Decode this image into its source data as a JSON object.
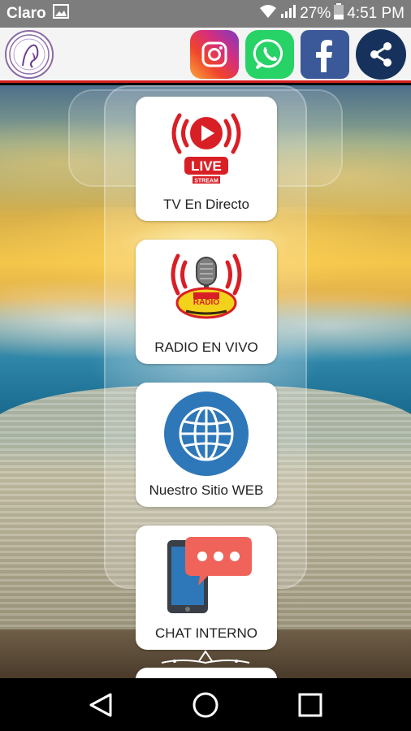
{
  "status_bar": {
    "carrier": "Claro",
    "battery": "27%",
    "time": "4:51 PM"
  },
  "app_bar": {
    "socials": [
      {
        "name": "instagram",
        "icon": "instagram-icon",
        "color": "#d42e7f"
      },
      {
        "name": "whatsapp",
        "icon": "whatsapp-icon",
        "color": "#27d266"
      },
      {
        "name": "facebook",
        "icon": "facebook-icon",
        "color": "#3b5998"
      },
      {
        "name": "share",
        "icon": "share-icon",
        "color": "#16325c"
      }
    ]
  },
  "menu": {
    "items": [
      {
        "label": "TV En Directo",
        "icon": "live-stream-icon",
        "badge_text": "LIVE",
        "badge_sub": "STREAM"
      },
      {
        "label": "RADIO EN VIVO",
        "icon": "radio-microphone-icon",
        "badge_text": "RADIO"
      },
      {
        "label": "Nuestro Sitio WEB",
        "icon": "globe-icon"
      },
      {
        "label": "CHAT INTERNO",
        "icon": "chat-phone-icon"
      }
    ]
  },
  "colors": {
    "accent_red": "#d62020",
    "live_red": "#d91f26",
    "globe_blue": "#2e77b8",
    "chat_coral": "#f0635a"
  }
}
